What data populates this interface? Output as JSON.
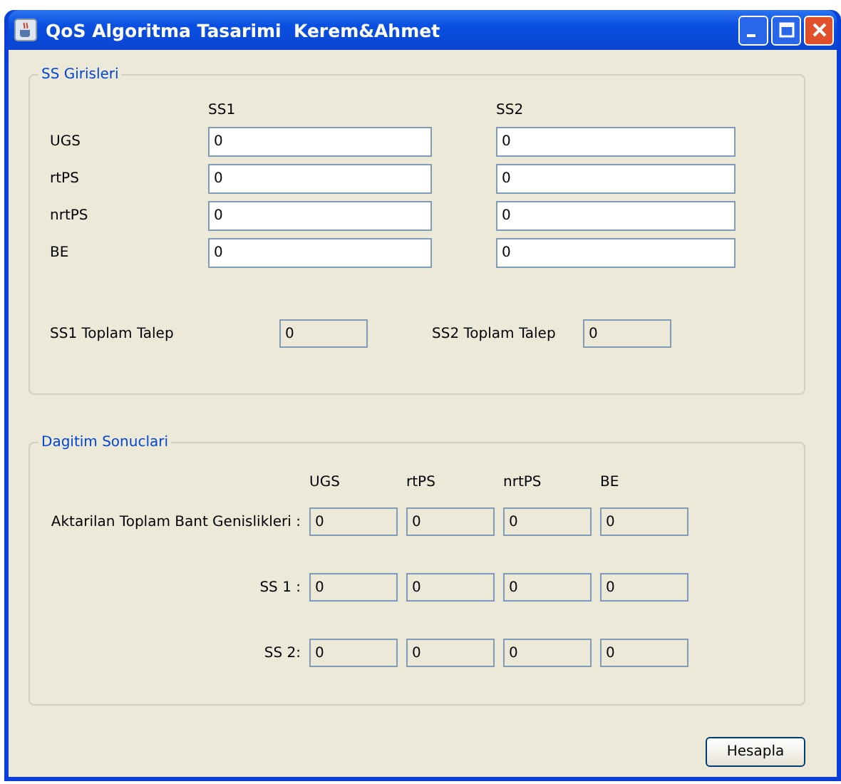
{
  "window": {
    "title": "QoS Algoritma Tasarimi  Kerem&Ahmet"
  },
  "inputs": {
    "title": "SS Girisleri",
    "columns": [
      "SS1",
      "SS2"
    ],
    "rows": [
      {
        "label": "UGS",
        "values": [
          "0",
          "0"
        ]
      },
      {
        "label": "rtPS",
        "values": [
          "0",
          "0"
        ]
      },
      {
        "label": "nrtPS",
        "values": [
          "0",
          "0"
        ]
      },
      {
        "label": "BE",
        "values": [
          "0",
          "0"
        ]
      }
    ],
    "totals": [
      {
        "label": "SS1 Toplam Talep",
        "value": "0"
      },
      {
        "label": "SS2 Toplam Talep",
        "value": "0"
      }
    ]
  },
  "results": {
    "title": "Dagitim Sonuclari",
    "columns": [
      "UGS",
      "rtPS",
      "nrtPS",
      "BE"
    ],
    "rows": [
      {
        "label": "Aktarilan Toplam Bant Genislikleri :",
        "values": [
          "0",
          "0",
          "0",
          "0"
        ]
      },
      {
        "label": "SS 1 :",
        "values": [
          "0",
          "0",
          "0",
          "0"
        ]
      },
      {
        "label": "SS 2:",
        "values": [
          "0",
          "0",
          "0",
          "0"
        ]
      }
    ]
  },
  "button": "Hesapla"
}
